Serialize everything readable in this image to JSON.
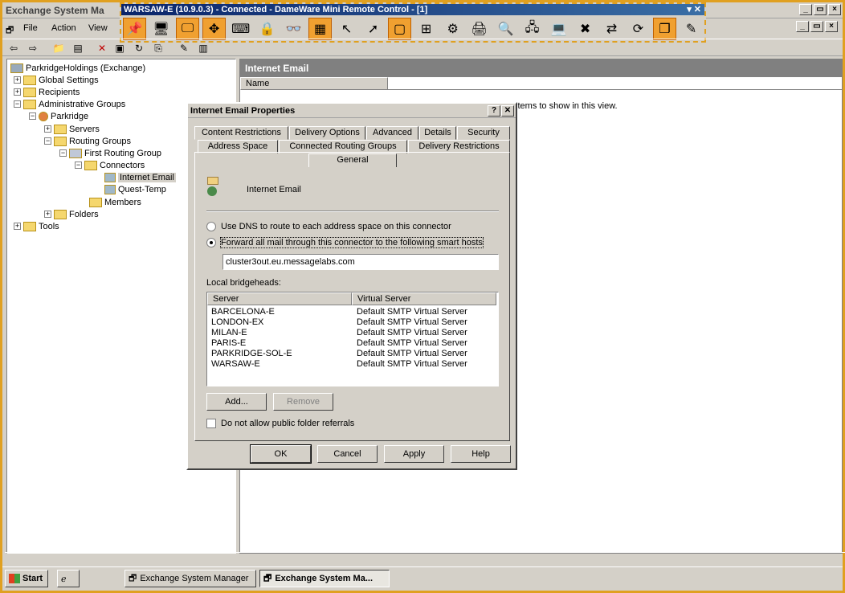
{
  "app": {
    "title": "Exchange System Ma",
    "restore_label": "▭",
    "min_label": "_",
    "close_label": "×"
  },
  "dameware": {
    "title": "WARSAW-E (10.9.0.3) - Connected - DameWare Mini Remote Control - [1]",
    "controls": "▾ ✕"
  },
  "menu": {
    "file": "File",
    "action": "Action",
    "view": "View"
  },
  "tree": {
    "root": "ParkridgeHoldings (Exchange)",
    "global_settings": "Global Settings",
    "recipients": "Recipients",
    "admin_groups": "Administrative Groups",
    "parkridge": "Parkridge",
    "servers": "Servers",
    "routing_groups": "Routing Groups",
    "first_routing_group": "First Routing Group",
    "connectors": "Connectors",
    "internet_email": "Internet Email",
    "quest_temp": "Quest-Temp",
    "members": "Members",
    "folders": "Folders",
    "tools": "Tools"
  },
  "right_pane": {
    "header": "Internet Email",
    "col_name": "Name",
    "empty_msg": "There are no items to show in this view."
  },
  "dialog": {
    "title": "Internet Email Properties",
    "help_btn": "?",
    "close_btn": "✕",
    "tabs_row1": [
      "Content Restrictions",
      "Delivery Options",
      "Advanced",
      "Details",
      "Security"
    ],
    "tabs_row2": [
      "Address Space",
      "Connected Routing Groups",
      "Delivery Restrictions"
    ],
    "active_tab": "General",
    "connector_name": "Internet Email",
    "radio_dns": "Use DNS to route to each address space on this connector",
    "radio_forward": "Forward all mail through this connector to the following smart hosts",
    "smart_host": "cluster3out.eu.messagelabs.com",
    "bridgeheads_label": "Local bridgeheads:",
    "col_server": "Server",
    "col_virtual": "Virtual Server",
    "rows": [
      {
        "server": "BARCELONA-E",
        "virtual": "Default SMTP Virtual Server"
      },
      {
        "server": "LONDON-EX",
        "virtual": "Default SMTP Virtual Server"
      },
      {
        "server": "MILAN-E",
        "virtual": "Default SMTP Virtual Server"
      },
      {
        "server": "PARIS-E",
        "virtual": "Default SMTP Virtual Server"
      },
      {
        "server": "PARKRIDGE-SOL-E",
        "virtual": "Default SMTP Virtual Server"
      },
      {
        "server": "WARSAW-E",
        "virtual": "Default SMTP Virtual Server"
      }
    ],
    "add_btn": "Add...",
    "remove_btn": "Remove",
    "no_public_folder": "Do not allow public folder referrals",
    "ok": "OK",
    "cancel": "Cancel",
    "apply": "Apply",
    "help": "Help"
  },
  "taskbar": {
    "start": "Start",
    "task1": "Exchange System Manager",
    "task2": "Exchange System Ma..."
  }
}
